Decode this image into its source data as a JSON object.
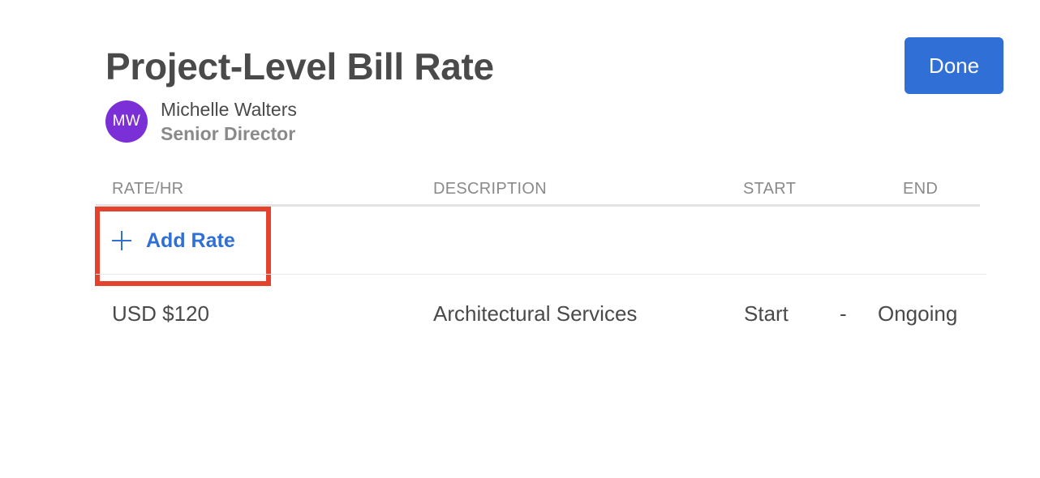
{
  "header": {
    "title": "Project-Level Bill Rate",
    "done_label": "Done"
  },
  "user": {
    "initials": "MW",
    "name": "Michelle Walters",
    "role": "Senior Director",
    "avatar_color": "#7b2fd6"
  },
  "table": {
    "columns": [
      "RATE/HR",
      "DESCRIPTION",
      "START",
      "END"
    ],
    "add_rate": {
      "icon": "plus-icon",
      "label": "Add Rate"
    },
    "rows": [
      {
        "rate": "USD $120",
        "description": "Architectural Services",
        "start": "Start",
        "separator": "-",
        "end": "Ongoing"
      }
    ]
  },
  "colors": {
    "accent": "#2f6fd6",
    "highlight_box": "#e4422d"
  }
}
